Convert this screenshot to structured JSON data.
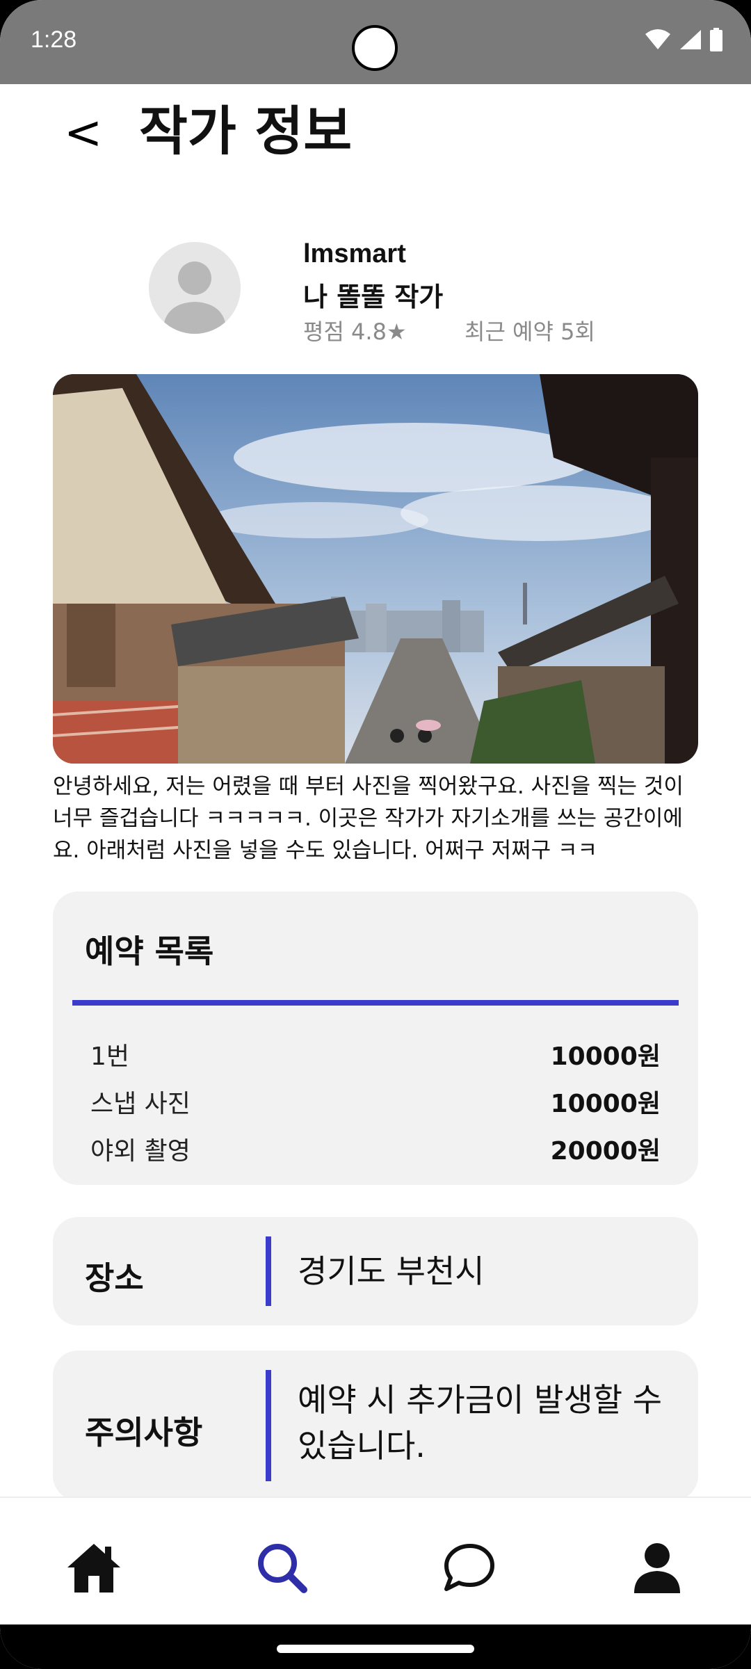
{
  "status_bar": {
    "time": "1:28"
  },
  "header": {
    "back_label": "<",
    "title": "작가 정보"
  },
  "profile": {
    "username": "lmsmart",
    "display_name": "나 똘똘 작가",
    "rating": "평점 4.8★",
    "recent_bookings": "최근 예약 5회"
  },
  "intro_text": "안녕하세요, 저는 어렸을 때 부터 사진을 찍어왔구요. 사진을 찍는 것이 너무 즐겁습니다 ㅋㅋㅋㅋㅋ. 이곳은 작가가 자기소개를 쓰는 공간이에요. 아래처럼 사진을 넣을 수도 있습니다. 어쩌구 저쩌구 ㅋㅋ",
  "booking": {
    "title": "예약 목록",
    "items": [
      {
        "name": "1번",
        "price": "10000원"
      },
      {
        "name": "스냅 사진",
        "price": "10000원"
      },
      {
        "name": "야외 촬영",
        "price": "20000원"
      }
    ]
  },
  "location": {
    "label": "장소",
    "value": "경기도 부천시"
  },
  "notice": {
    "label": "주의사항",
    "value": "예약 시 추가금이 발생할 수 있습니다."
  },
  "nav": {
    "items": [
      {
        "icon": "home-icon",
        "active": false
      },
      {
        "icon": "search-icon",
        "active": true
      },
      {
        "icon": "chat-icon",
        "active": false
      },
      {
        "icon": "profile-icon",
        "active": false
      }
    ]
  },
  "colors": {
    "accent": "#3b3bcc",
    "card_bg": "#f2f2f2",
    "status_bar": "#7a7a7a"
  }
}
